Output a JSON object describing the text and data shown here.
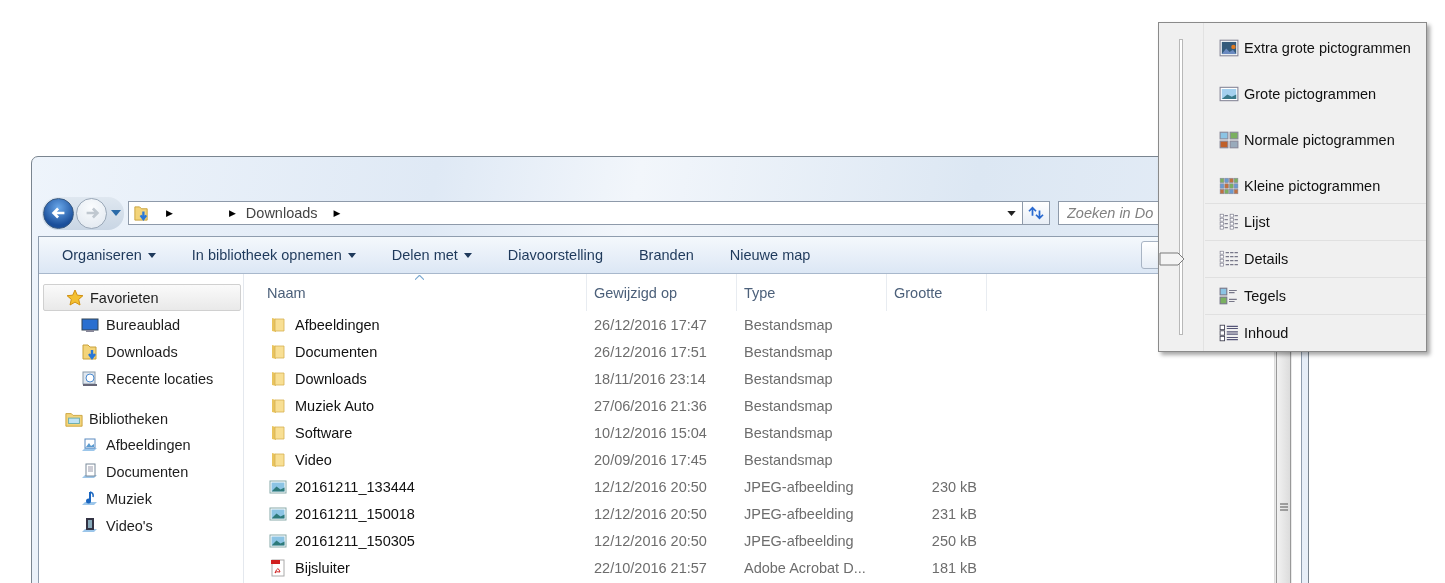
{
  "navigation": {
    "back_disabled": false,
    "forward_disabled": true,
    "breadcrumb": [
      {
        "kind": "arrow",
        "text": "▶"
      },
      {
        "kind": "arrow",
        "text": "▶"
      },
      {
        "kind": "crumb",
        "text": "Downloads"
      },
      {
        "kind": "arrow",
        "text": "▶"
      }
    ],
    "search": {
      "placeholder": "Zoeken in Do"
    }
  },
  "toolbar": [
    {
      "label": "Organiseren",
      "dropdown": true
    },
    {
      "label": "In bibliotheek opnemen",
      "dropdown": true
    },
    {
      "label": "Delen met",
      "dropdown": true
    },
    {
      "label": "Diavoorstelling",
      "dropdown": false
    },
    {
      "label": "Branden",
      "dropdown": false
    },
    {
      "label": "Nieuwe map",
      "dropdown": false
    }
  ],
  "sidebar": [
    {
      "label": "Favorieten",
      "kind": "favorites",
      "selected": true,
      "children": [
        {
          "label": "Bureaublad",
          "kind": "desktop"
        },
        {
          "label": "Downloads",
          "kind": "downloads"
        },
        {
          "label": "Recente locaties",
          "kind": "recent"
        }
      ]
    },
    {
      "label": "Bibliotheken",
      "kind": "libraries",
      "selected": false,
      "children": [
        {
          "label": "Afbeeldingen",
          "kind": "pictures"
        },
        {
          "label": "Documenten",
          "kind": "documents"
        },
        {
          "label": "Muziek",
          "kind": "music"
        },
        {
          "label": "Video's",
          "kind": "videos"
        }
      ]
    }
  ],
  "table": {
    "columns": [
      {
        "label": "Naam",
        "sorted": true
      },
      {
        "label": "Gewijzigd op",
        "sorted": false
      },
      {
        "label": "Type",
        "sorted": false
      },
      {
        "label": "Grootte",
        "sorted": false
      }
    ],
    "rows": [
      {
        "kind": "folder",
        "name": "Afbeeldingen",
        "modified": "26/12/2016 17:47",
        "type": "Bestandsmap"
      },
      {
        "kind": "folder",
        "name": "Documenten",
        "modified": "26/12/2016 17:51",
        "type": "Bestandsmap"
      },
      {
        "kind": "folder",
        "name": "Downloads",
        "modified": "18/11/2016 23:14",
        "type": "Bestandsmap"
      },
      {
        "kind": "folder",
        "name": "Muziek Auto",
        "modified": "27/06/2016 21:36",
        "type": "Bestandsmap"
      },
      {
        "kind": "folder",
        "name": "Software",
        "modified": "10/12/2016 15:04",
        "type": "Bestandsmap"
      },
      {
        "kind": "folder",
        "name": "Video",
        "modified": "20/09/2016 17:45",
        "type": "Bestandsmap"
      },
      {
        "kind": "image",
        "name": "20161211_133444",
        "modified": "12/12/2016 20:50",
        "type": "JPEG-afbeelding",
        "size": "230 kB"
      },
      {
        "kind": "image",
        "name": "20161211_150018",
        "modified": "12/12/2016 20:50",
        "type": "JPEG-afbeelding",
        "size": "231 kB"
      },
      {
        "kind": "image",
        "name": "20161211_150305",
        "modified": "12/12/2016 20:50",
        "type": "JPEG-afbeelding",
        "size": "250 kB"
      },
      {
        "kind": "pdf",
        "name": "Bijsluiter",
        "modified": "22/10/2016 21:57",
        "type": "Adobe Acrobat D...",
        "size": "181 kB"
      }
    ]
  },
  "view_menu": {
    "icon_sizes": [
      {
        "label": "Extra grote pictogrammen",
        "selected": false
      },
      {
        "label": "Grote pictogrammen",
        "selected": false
      },
      {
        "label": "Normale pictogrammen",
        "selected": false
      },
      {
        "label": "Kleine pictogrammen",
        "selected": false
      }
    ],
    "layouts": [
      {
        "label": "Lijst",
        "selected": false
      },
      {
        "label": "Details",
        "selected": true
      },
      {
        "label": "Tegels",
        "selected": false
      },
      {
        "label": "Inhoud",
        "selected": false
      }
    ]
  }
}
